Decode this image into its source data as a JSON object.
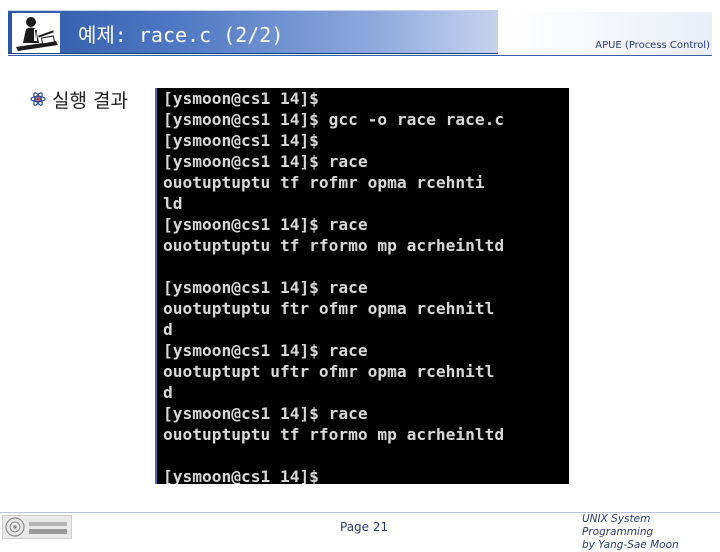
{
  "header": {
    "title": "예제: race.c (2/2)",
    "course": "APUE (Process Control)"
  },
  "body": {
    "bullet_label": "실행 결과"
  },
  "terminal": {
    "lines": [
      "[ysmoon@cs1 14]$",
      "[ysmoon@cs1 14]$ gcc -o race race.c",
      "[ysmoon@cs1 14]$",
      "[ysmoon@cs1 14]$ race",
      "ouotuptuptu tf rofmr opma rcehnti",
      "ld",
      "[ysmoon@cs1 14]$ race",
      "ouotuptuptu tf rformo mp acrheinltd",
      "",
      "[ysmoon@cs1 14]$ race",
      "ouotuptuptu ftr ofmr opma rcehnitl",
      "d",
      "[ysmoon@cs1 14]$ race",
      "ouotuptupt uftr ofmr opma rcehnitl",
      "d",
      "[ysmoon@cs1 14]$ race",
      "ouotuptuptu tf rformo mp acrheinltd",
      "",
      "[ysmoon@cs1 14]$"
    ]
  },
  "footer": {
    "page": "Page 21",
    "course_line1": "UNIX System Programming",
    "course_line2": "by Yang-Sae Moon"
  },
  "colors": {
    "title_bar": "#2c57a6",
    "terminal_bg": "#000000",
    "terminal_text": "#d8d8d8",
    "accent_text": "#2a3c74"
  }
}
